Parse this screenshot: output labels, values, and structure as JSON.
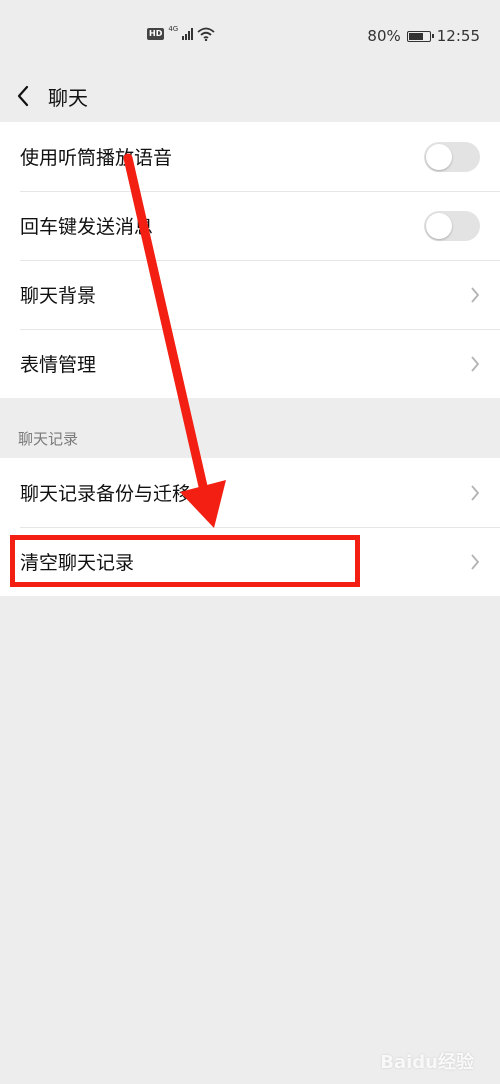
{
  "status_bar": {
    "hd": "HD",
    "network": "4G",
    "battery_percent": "80%",
    "battery_level": 0.8,
    "time": "12:55"
  },
  "header": {
    "title": "聊天",
    "back_icon": "chevron-left-icon"
  },
  "settings_group_1": [
    {
      "label": "使用听筒播放语音",
      "control": "toggle",
      "on": false
    },
    {
      "label": "回车键发送消息",
      "control": "toggle",
      "on": false
    },
    {
      "label": "聊天背景",
      "control": "chevron-right-icon"
    },
    {
      "label": "表情管理",
      "control": "chevron-right-icon"
    }
  ],
  "chat_history_section": {
    "header": "聊天记录",
    "items": [
      {
        "label": "聊天记录备份与迁移",
        "control": "chevron-right-icon"
      },
      {
        "label": "清空聊天记录",
        "control": "chevron-right-icon"
      }
    ]
  },
  "annotations": {
    "color": "#f21f12",
    "highlight_target": "清空聊天记录"
  },
  "watermark": "Baidu经验"
}
